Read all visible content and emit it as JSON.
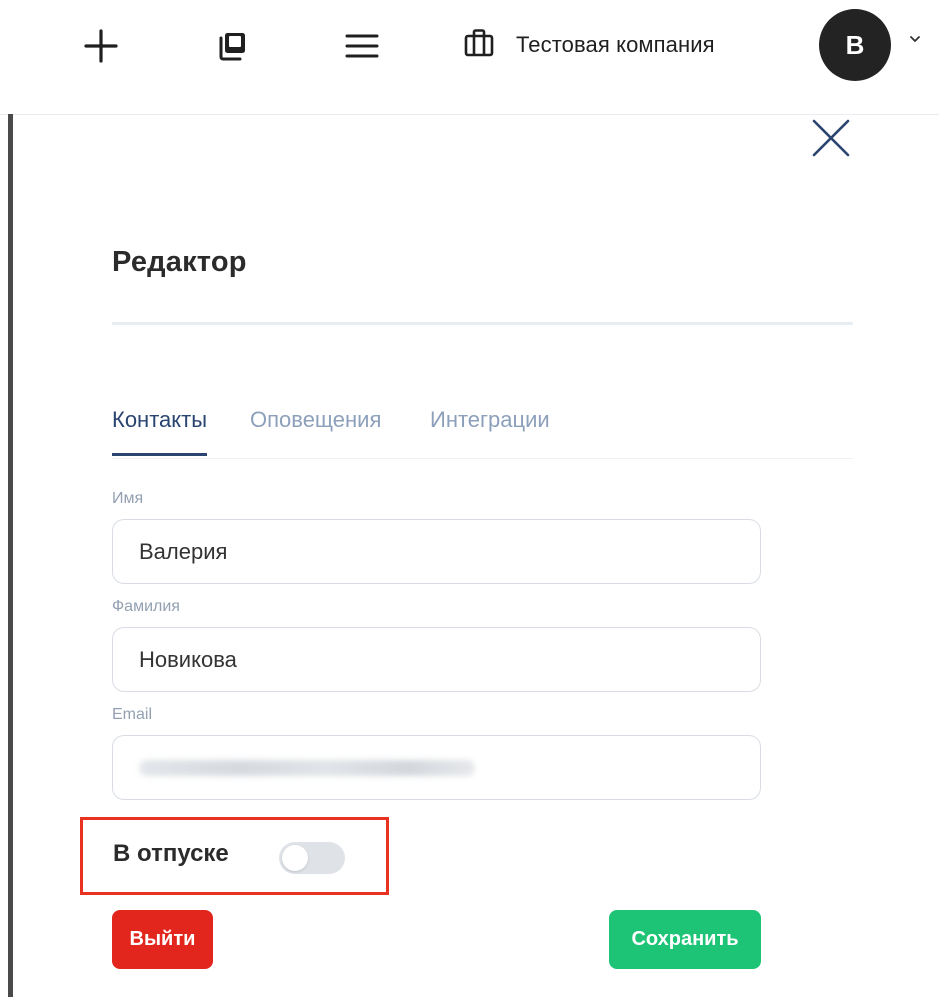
{
  "header": {
    "add_icon": "plus-icon",
    "copy_icon": "copy-icon",
    "menu_icon": "menu-icon",
    "company_icon": "briefcase-icon",
    "company_name": "Тестовая компания",
    "avatar_letter": "В",
    "avatar_color": "#232323",
    "chevron_icon": "chevron-down-icon"
  },
  "panel": {
    "close_icon": "close-icon",
    "title": "Редактор",
    "tabs": [
      {
        "label": "Контакты",
        "active": true
      },
      {
        "label": "Оповещения",
        "active": false
      },
      {
        "label": "Интеграции",
        "active": false
      }
    ],
    "fields": {
      "first_name": {
        "label": "Имя",
        "value": "Валерия"
      },
      "last_name": {
        "label": "Фамилия",
        "value": "Новикова"
      },
      "email": {
        "label": "Email",
        "value": ""
      }
    },
    "vacation": {
      "label": "В отпуске",
      "enabled": false,
      "highlight_color": "#e8321f"
    },
    "buttons": {
      "logout": "Выйти",
      "save": "Сохранить"
    },
    "colors": {
      "accent": "#2a4470",
      "inactive_tab": "#8da0bb",
      "logout": "#e2261e",
      "save": "#1ec476"
    }
  }
}
